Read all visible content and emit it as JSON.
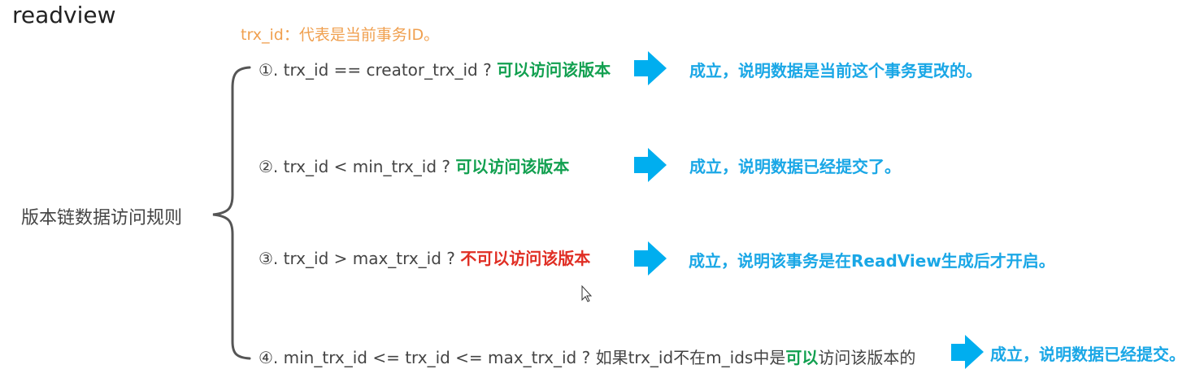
{
  "title": "readview",
  "note": "trx_id：代表是当前事务ID。",
  "root_label": "版本链数据访问规则",
  "colors": {
    "note": "#F0A050",
    "allowed": "#12A050",
    "denied": "#E02E24",
    "conclusion": "#1AA7E6",
    "arrow": "#00AEEF",
    "brace": "#555555"
  },
  "rules": [
    {
      "condition": "①. trx_id  == creator_trx_id ? ",
      "verdict": "可以访问该版本",
      "verdict_type": "allowed",
      "conclusion": "成立，说明数据是当前这个事务更改的。"
    },
    {
      "condition": "②. trx_id < min_trx_id ? ",
      "verdict": "可以访问该版本",
      "verdict_type": "allowed",
      "conclusion": "成立，说明数据已经提交了。"
    },
    {
      "condition": "③. trx_id > max_trx_id ?  ",
      "verdict": "不可以访问该版本",
      "verdict_type": "denied",
      "conclusion": "成立，说明该事务是在ReadView生成后才开启。"
    },
    {
      "condition": "④. min_trx_id <= trx_id <= max_trx_id ?  如果trx_id不在m_ids中是",
      "verdict": "可以",
      "verdict_suffix": "访问该版本的",
      "verdict_type": "allowed",
      "conclusion": "成立，说明数据已经提交。"
    }
  ]
}
